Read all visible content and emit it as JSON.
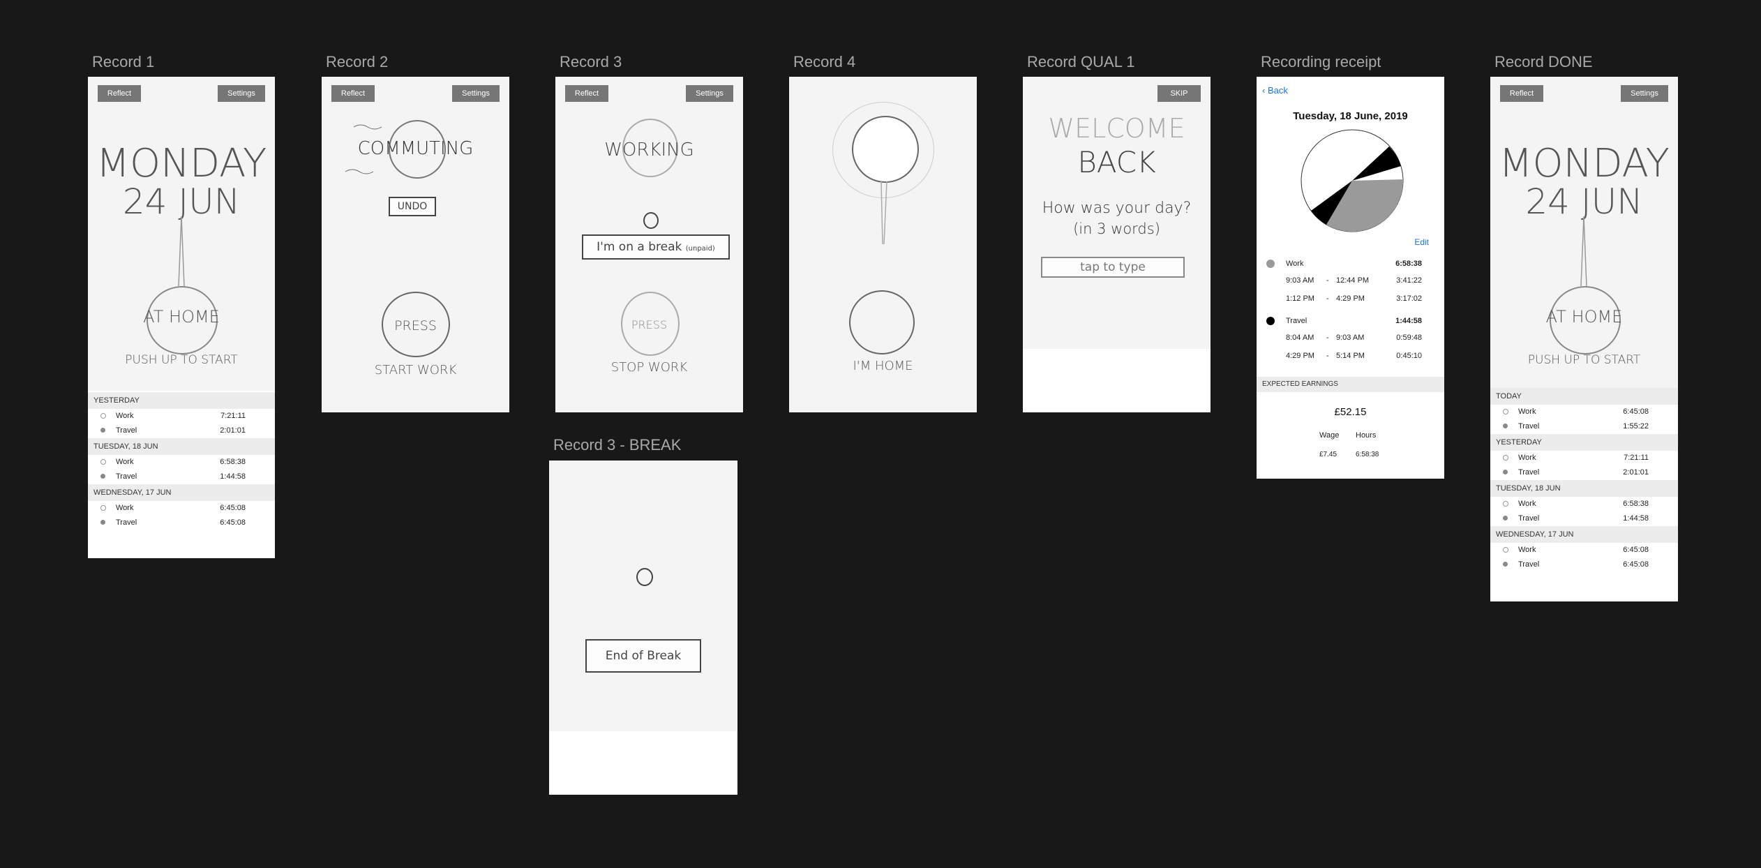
{
  "frames": {
    "record1": {
      "title": "Record 1",
      "reflect": "Reflect",
      "settings": "Settings",
      "day": "MONDAY",
      "date": "24 JUN",
      "bubble": "AT HOME",
      "hint": "PUSH UP TO START",
      "groups": [
        {
          "header": "YESTERDAY",
          "rows": [
            {
              "name": "Work",
              "value": "7:21:11"
            },
            {
              "name": "Travel",
              "value": "2:01:01"
            }
          ]
        },
        {
          "header": "TUESDAY, 18 JUN",
          "rows": [
            {
              "name": "Work",
              "value": "6:58:38"
            },
            {
              "name": "Travel",
              "value": "1:44:58"
            }
          ]
        },
        {
          "header": "WEDNESDAY, 17 JUN",
          "rows": [
            {
              "name": "Work",
              "value": "6:45:08"
            },
            {
              "name": "Travel",
              "value": "6:45:08"
            }
          ]
        }
      ]
    },
    "record2": {
      "title": "Record 2",
      "reflect": "Reflect",
      "settings": "Settings",
      "state": "COMMUTING",
      "undo": "UNDO",
      "press": "PRESS",
      "action": "START WORK"
    },
    "record3": {
      "title": "Record 3",
      "reflect": "Reflect",
      "settings": "Settings",
      "state": "WORKING",
      "break_btn": "I'm on a break",
      "break_note": "(unpaid)",
      "press": "PRESS",
      "action": "STOP WORK"
    },
    "record4": {
      "title": "Record 4",
      "action": "I'M HOME"
    },
    "qual": {
      "title": "Record QUAL 1",
      "skip": "SKIP",
      "welcome": "WELCOME",
      "back": "BACK",
      "question": "How was your day?",
      "question2": "(in 3 words)",
      "input": "tap to type"
    },
    "receipt": {
      "title": "Recording receipt",
      "back": "Back",
      "date": "Tuesday, 18 June, 2019",
      "edit": "Edit",
      "work": {
        "name": "Work",
        "total": "6:58:38",
        "rows": [
          {
            "from": "9:03 AM",
            "to": "12:44 PM",
            "dur": "3:41:22"
          },
          {
            "from": "1:12 PM",
            "to": "4:29 PM",
            "dur": "3:17:02"
          }
        ]
      },
      "travel": {
        "name": "Travel",
        "total": "1:44:58",
        "rows": [
          {
            "from": "8:04 AM",
            "to": "9:03 AM",
            "dur": "0:59:48"
          },
          {
            "from": "4:29 PM",
            "to": "5:14 PM",
            "dur": "0:45:10"
          }
        ]
      },
      "sep": "-",
      "earnings_header": "EXPECTED EARNINGS",
      "earnings": "£52.15",
      "wage_label": "Wage",
      "hours_label": "Hours",
      "wage": "£7.45",
      "hours": "6:58:38"
    },
    "done": {
      "title": "Record DONE",
      "reflect": "Reflect",
      "settings": "Settings",
      "day": "MONDAY",
      "date": "24 JUN",
      "bubble": "AT HOME",
      "hint": "PUSH UP TO START",
      "groups": [
        {
          "header": "TODAY",
          "rows": [
            {
              "name": "Work",
              "value": "6:45:08"
            },
            {
              "name": "Travel",
              "value": "1:55:22"
            }
          ]
        },
        {
          "header": "YESTERDAY",
          "rows": [
            {
              "name": "Work",
              "value": "7:21:11"
            },
            {
              "name": "Travel",
              "value": "2:01:01"
            }
          ]
        },
        {
          "header": "TUESDAY, 18 JUN",
          "rows": [
            {
              "name": "Work",
              "value": "6:58:38"
            },
            {
              "name": "Travel",
              "value": "1:44:58"
            }
          ]
        },
        {
          "header": "WEDNESDAY, 17 JUN",
          "rows": [
            {
              "name": "Work",
              "value": "6:45:08"
            },
            {
              "name": "Travel",
              "value": "6:45:08"
            }
          ]
        }
      ]
    },
    "break": {
      "title": "Record 3 - BREAK",
      "end": "End of Break"
    }
  },
  "colors": {
    "canvas": "#181819",
    "button": "#767676",
    "link": "#1a73e8"
  }
}
